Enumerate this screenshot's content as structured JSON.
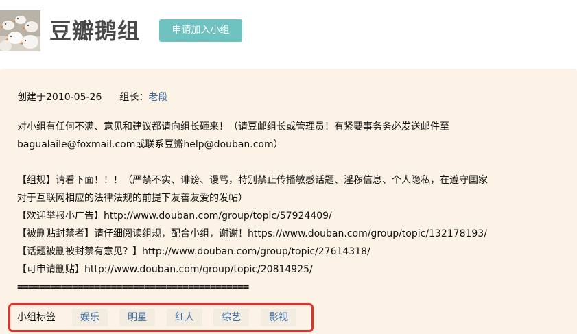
{
  "group": {
    "title": "豆瓣鹅组",
    "join_button": "申请加入小组"
  },
  "meta": {
    "created": "创建于2010-05-26",
    "leader_label": "组长：",
    "leader_name": "老段"
  },
  "description": {
    "lines": [
      "对小组有任何不满、意见和建议都请向组长砸来！（请豆邮组长或管理员！有紧要事务务必发送邮件至",
      "bagualaile@foxmail.com或联系豆瓣help@douban.com）",
      "",
      "【组规】请看下面！！！（严禁不实、诽谤、谩骂，特别禁止传播敏感话题、淫秽信息、个人隐私，在遵守国家",
      "对于互联网相应的法律法规的前提下友善友爱的发帖）",
      "【欢迎举报小广告】http://www.douban.com/group/topic/57924409/",
      "【被删贴封禁者】请仔细阅读组规，配合小组，谢谢！https://www.douban.com/group/topic/132178193/",
      "【话题被删被封禁有意见？】http://www.douban.com/group/topic/27614318/",
      "【可申请删贴】http://www.douban.com/group/topic/20814925/"
    ],
    "separator": "=========================================="
  },
  "tags": {
    "label": "小组标签",
    "items": [
      "娱乐",
      "明星",
      "红人",
      "综艺",
      "影视"
    ]
  },
  "colors": {
    "join_button_bg": "#6ec3c1",
    "panel_bg": "#fdf2e6",
    "link": "#3a6ea5",
    "highlight_border": "#e0302a"
  }
}
